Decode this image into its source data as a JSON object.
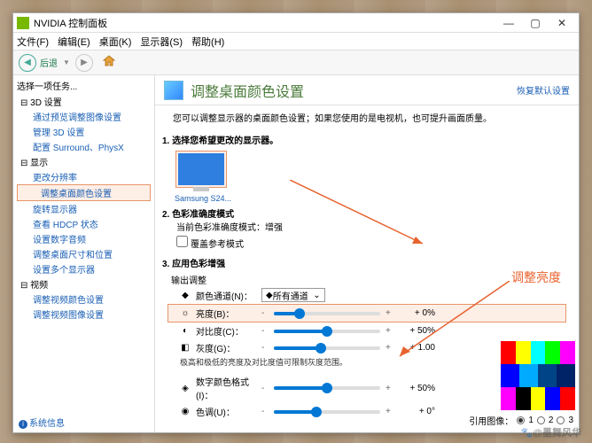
{
  "window": {
    "title": "NVIDIA 控制面板"
  },
  "menu": {
    "file": "文件(F)",
    "edit": "编辑(E)",
    "desktop": "桌面(K)",
    "display": "显示器(S)",
    "help": "帮助(H)"
  },
  "nav": {
    "back": "后退"
  },
  "sidebar": {
    "task": "选择一项任务...",
    "n3d": "3D 设置",
    "n3d_preview": "通过预览调整图像设置",
    "n3d_manage": "管理 3D 设置",
    "n3d_surround": "配置 Surround、PhysX",
    "disp": "显示",
    "disp_res": "更改分辨率",
    "disp_color": "调整桌面颜色设置",
    "disp_rotate": "旋转显示器",
    "disp_hdcp": "查看 HDCP 状态",
    "disp_audio": "设置数字音频",
    "disp_size": "调整桌面尺寸和位置",
    "disp_multi": "设置多个显示器",
    "video": "视频",
    "video_color": "调整视频颜色设置",
    "video_image": "调整视频图像设置",
    "sysinfo": "系统信息"
  },
  "header": {
    "title": "调整桌面颜色设置",
    "restore": "恢复默认设置"
  },
  "desc": "您可以调整显示器的桌面颜色设置；如果您使用的是电视机，也可提升画面质量。",
  "s1": {
    "title": "1. 选择您希望更改的显示器。",
    "monitor": "Samsung S24..."
  },
  "s2": {
    "title": "2. 色彩准确度模式",
    "cur": "当前色彩准确度模式：增强",
    "chk": "覆盖参考模式"
  },
  "s3": {
    "title": "3. 应用色彩增强",
    "sub": "输出调整",
    "channel_lbl": "颜色通道(N)：",
    "channel_val": "所有通道",
    "brightness": "亮度(B)：",
    "brightness_val": "+ 0%",
    "contrast": "对比度(C)：",
    "contrast_val": "+ 50%",
    "gamma": "灰度(G)：",
    "gamma_val": "+ 1.00",
    "note": "极高和极低的亮度及对比度值可限制灰度范围。",
    "digitalvib": "数字颜色格式(I)：",
    "digitalvib_val": "+ 50%",
    "hue": "色调(U)：",
    "hue_val": "+ 0°"
  },
  "anno": "调整亮度",
  "ref": {
    "label": "引用图像：",
    "r1": "1",
    "r2": "2",
    "r3": "3"
  },
  "watermark": "🐾@墨舞风华"
}
